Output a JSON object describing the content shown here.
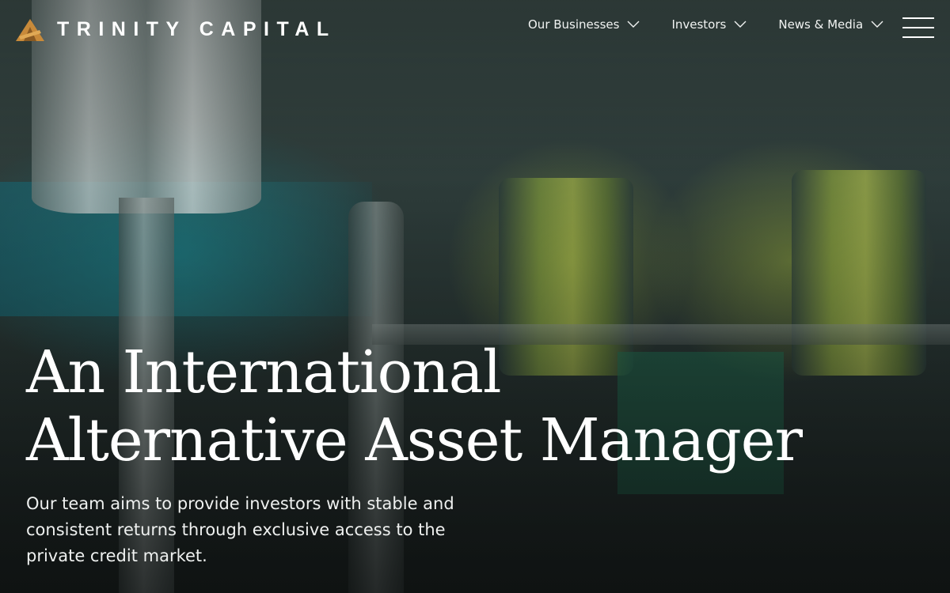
{
  "header": {
    "logo_text": "TRINITY CAPITAL",
    "logo_icon": "triangle-logo-icon",
    "nav": [
      {
        "label": "Our Businesses",
        "icon": "chevron-down-icon"
      },
      {
        "label": "Investors",
        "icon": "chevron-down-icon"
      },
      {
        "label": "News & Media",
        "icon": "chevron-down-icon"
      }
    ],
    "menu_icon": "hamburger-menu-icon"
  },
  "hero": {
    "title_line1": "An International",
    "title_line2": "Alternative Asset Manager",
    "subtitle": "Our team aims to provide investors with stable and consistent returns through exclusive access to the private credit market."
  },
  "colors": {
    "logo_accent": "#c88a3a",
    "text": "#ffffff"
  }
}
